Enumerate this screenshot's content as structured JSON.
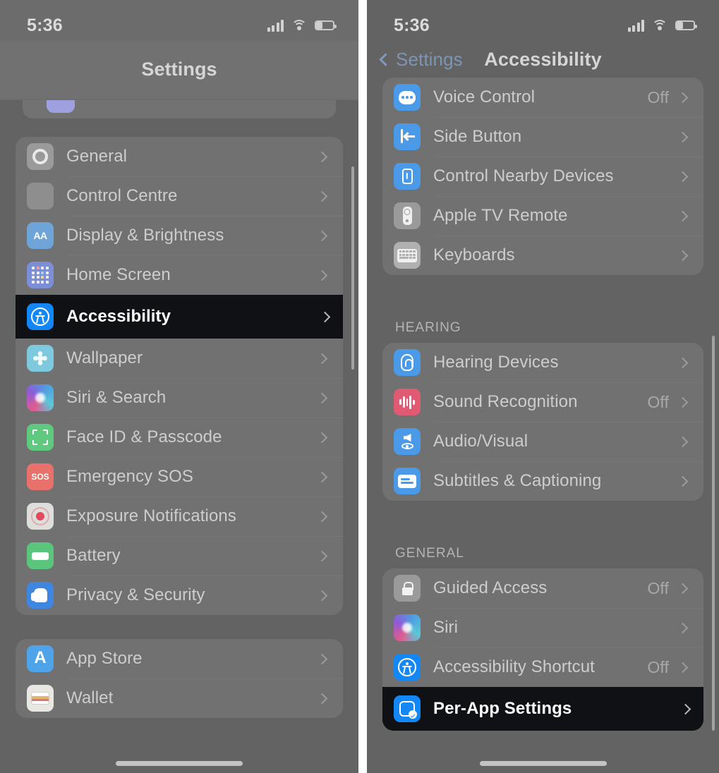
{
  "left_screen": {
    "status_bar": {
      "time": "5:36",
      "signal_icon": "cellular-bars-icon",
      "wifi_icon": "wifi-icon",
      "battery_icon": "battery-icon",
      "battery_level_pct": 38
    },
    "nav": {
      "title": "Settings"
    },
    "groups": [
      {
        "items": [
          {
            "label": "General",
            "icon": "gear-icon",
            "icon_class": "ic-general",
            "value": "",
            "highlighted": false
          },
          {
            "label": "Control Centre",
            "icon": "toggles-icon",
            "icon_class": "ic-cc",
            "value": "",
            "highlighted": false
          },
          {
            "label": "Display & Brightness",
            "icon": "aa-text-icon",
            "icon_class": "ic-aa",
            "value": "",
            "highlighted": false
          },
          {
            "label": "Home Screen",
            "icon": "app-grid-icon",
            "icon_class": "ic-home",
            "value": "",
            "highlighted": false
          },
          {
            "label": "Accessibility",
            "icon": "accessibility-icon",
            "icon_class": "ic-access",
            "value": "",
            "highlighted": true
          },
          {
            "label": "Wallpaper",
            "icon": "flower-icon",
            "icon_class": "ic-wall",
            "value": "",
            "highlighted": false
          },
          {
            "label": "Siri & Search",
            "icon": "siri-orb-icon",
            "icon_class": "ic-siri",
            "value": "",
            "highlighted": false
          },
          {
            "label": "Face ID & Passcode",
            "icon": "face-id-icon",
            "icon_class": "ic-faceid",
            "value": "",
            "highlighted": false
          },
          {
            "label": "Emergency SOS",
            "icon": "sos-icon",
            "icon_class": "ic-sos",
            "value": "",
            "highlighted": false
          },
          {
            "label": "Exposure Notifications",
            "icon": "exposure-icon",
            "icon_class": "ic-expo",
            "value": "",
            "highlighted": false
          },
          {
            "label": "Battery",
            "icon": "battery-icon",
            "icon_class": "ic-batt",
            "value": "",
            "highlighted": false
          },
          {
            "label": "Privacy & Security",
            "icon": "hand-icon",
            "icon_class": "ic-privacy",
            "value": "",
            "highlighted": false
          }
        ]
      },
      {
        "items": [
          {
            "label": "App Store",
            "icon": "app-store-icon",
            "icon_class": "ic-appstore",
            "value": "",
            "highlighted": false
          },
          {
            "label": "Wallet",
            "icon": "wallet-icon",
            "icon_class": "ic-wallet",
            "value": "",
            "highlighted": false
          }
        ]
      }
    ]
  },
  "right_screen": {
    "status_bar": {
      "time": "5:36",
      "signal_icon": "cellular-bars-icon",
      "wifi_icon": "wifi-icon",
      "battery_icon": "battery-icon",
      "battery_level_pct": 38
    },
    "nav": {
      "back_label": "Settings",
      "title": "Accessibility",
      "back_icon": "chevron-left-icon"
    },
    "groups": [
      {
        "header": "",
        "items": [
          {
            "label": "Voice Control",
            "icon": "voice-control-icon",
            "icon_class": "ic-voice",
            "value": "Off",
            "highlighted": false
          },
          {
            "label": "Side Button",
            "icon": "side-button-icon",
            "icon_class": "ic-side",
            "value": "",
            "highlighted": false
          },
          {
            "label": "Control Nearby Devices",
            "icon": "nearby-device-icon",
            "icon_class": "ic-nearby",
            "value": "",
            "highlighted": false
          },
          {
            "label": "Apple TV Remote",
            "icon": "apple-tv-remote-icon",
            "icon_class": "ic-atv",
            "value": "",
            "highlighted": false
          },
          {
            "label": "Keyboards",
            "icon": "keyboard-icon",
            "icon_class": "ic-kb",
            "value": "",
            "highlighted": false
          }
        ]
      },
      {
        "header": "HEARING",
        "items": [
          {
            "label": "Hearing Devices",
            "icon": "ear-icon",
            "icon_class": "ic-hearing",
            "value": "",
            "highlighted": false
          },
          {
            "label": "Sound Recognition",
            "icon": "sound-wave-icon",
            "icon_class": "ic-sound",
            "value": "Off",
            "highlighted": false
          },
          {
            "label": "Audio/Visual",
            "icon": "speaker-eye-icon",
            "icon_class": "ic-av",
            "value": "",
            "highlighted": false
          },
          {
            "label": "Subtitles & Captioning",
            "icon": "captions-icon",
            "icon_class": "ic-sub",
            "value": "",
            "highlighted": false
          }
        ]
      },
      {
        "header": "GENERAL",
        "items": [
          {
            "label": "Guided Access",
            "icon": "lock-icon",
            "icon_class": "ic-guided",
            "value": "Off",
            "highlighted": false
          },
          {
            "label": "Siri",
            "icon": "siri-orb-icon",
            "icon_class": "ic-siri",
            "value": "",
            "highlighted": false
          },
          {
            "label": "Accessibility Shortcut",
            "icon": "accessibility-icon",
            "icon_class": "ic-access",
            "value": "Off",
            "highlighted": false
          },
          {
            "label": "Per-App Settings",
            "icon": "per-app-icon",
            "icon_class": "ic-perapp",
            "value": "",
            "highlighted": true
          }
        ]
      }
    ]
  },
  "colors": {
    "highlight_bg": "#0b0b0d",
    "panel_bg": "#636363",
    "card_bg": "rgba(124,124,124,0.60)",
    "accent_blue": "#1387f5",
    "back_link_blue": "#7e95b1",
    "label_text": "#cdcdcd",
    "value_text": "#a9a9a9"
  }
}
